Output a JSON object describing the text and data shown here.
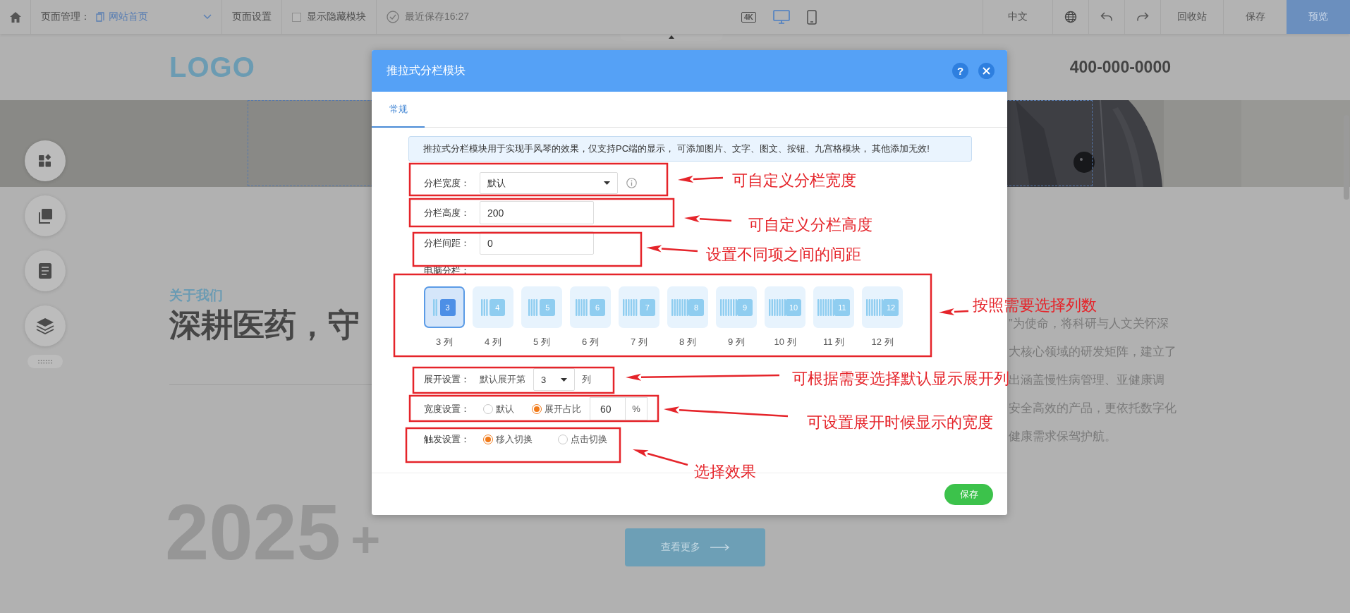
{
  "toolbar": {
    "page_label": "页面管理：",
    "page_name": "网站首页",
    "page_settings": "页面设置",
    "show_hidden": {
      "label": "显示隐藏模块",
      "checked": false
    },
    "last_saved": "最近保存16:27",
    "devices": [
      {
        "kind": "badge",
        "label": "4K",
        "selected": false
      },
      {
        "kind": "desktop",
        "selected": true
      },
      {
        "kind": "mobile",
        "selected": false
      }
    ],
    "language": "中文",
    "recycle_bin": "回收站",
    "save": "保存",
    "preview": "预览"
  },
  "site": {
    "logo": "LOGO",
    "phone": "400-000-0000",
    "section_label": "关于我们",
    "headline": "深耕医药，守",
    "paragraph_lines": [
      "”为使命，将科研与人文关怀深",
      "大核心领域的研发矩阵，建立了",
      "出涵盖慢性病管理、亚健康调",
      "安全高效的产品，更依托数字化",
      "健康需求保驾护航。"
    ],
    "year": "2025",
    "year_suffix": "+",
    "more_button": "查看更多"
  },
  "dialog": {
    "title": "推拉式分栏模块",
    "help": "?",
    "tabs": [
      {
        "label": "常规",
        "selected": true
      }
    ],
    "notice": "推拉式分栏模块用于实现手风琴的效果，仅支持PC端的显示， 可添加图片、文字、图文、按钮、九宫格模块， 其他添加无效!",
    "width_field": {
      "label": "分栏宽度：",
      "value": "默认"
    },
    "height_field": {
      "label": "分栏高度：",
      "value": "200"
    },
    "gap_field": {
      "label": "分栏间距：",
      "value": "0"
    },
    "columns_label": "电脑分栏：",
    "columns": [
      {
        "number": "3",
        "label": "3 列",
        "selected": true
      },
      {
        "number": "4",
        "label": "4 列",
        "selected": false
      },
      {
        "number": "5",
        "label": "5 列",
        "selected": false
      },
      {
        "number": "6",
        "label": "6 列",
        "selected": false
      },
      {
        "number": "7",
        "label": "7 列",
        "selected": false
      },
      {
        "number": "8",
        "label": "8 列",
        "selected": false
      },
      {
        "number": "9",
        "label": "9 列",
        "selected": false
      },
      {
        "number": "10",
        "label": "10 列",
        "selected": false
      },
      {
        "number": "11",
        "label": "11 列",
        "selected": false
      },
      {
        "number": "12",
        "label": "12 列",
        "selected": false
      }
    ],
    "expand": {
      "label": "展开设置：",
      "prefix": "默认展开第",
      "value": "3",
      "suffix": "列"
    },
    "width_setting": {
      "label": "宽度设置：",
      "options": [
        {
          "label": "默认",
          "selected": false
        },
        {
          "label": "展开占比",
          "selected": true
        }
      ],
      "value": "60",
      "unit": "%"
    },
    "trigger": {
      "label": "触发设置：",
      "options": [
        {
          "label": "移入切换",
          "selected": true
        },
        {
          "label": "点击切换",
          "selected": false
        }
      ]
    },
    "save": "保存"
  },
  "annotations": [
    {
      "text": "可自定义分栏宽度"
    },
    {
      "text": "可自定义分栏高度"
    },
    {
      "text": "设置不同项之间的间距"
    },
    {
      "text": "按照需要选择列数"
    },
    {
      "text": "可根据需要选择默认显示展开列"
    },
    {
      "text": "可设置展开时候显示的宽度"
    },
    {
      "text": "选择效果"
    }
  ]
}
